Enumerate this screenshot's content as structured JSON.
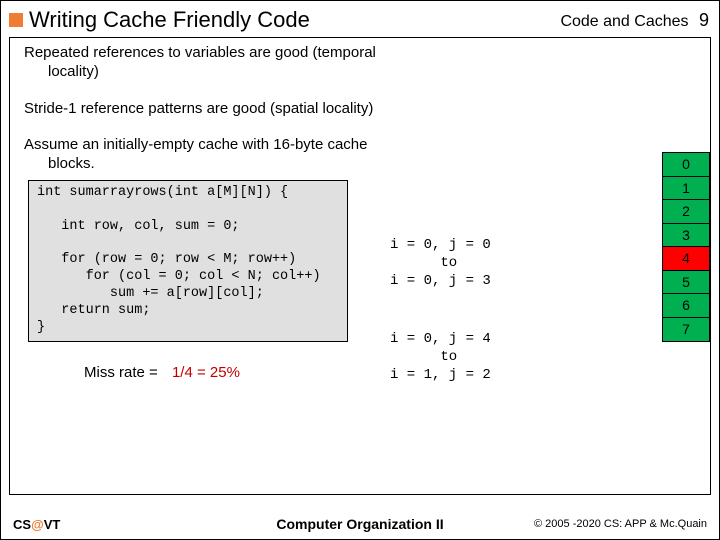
{
  "header": {
    "title": "Writing Cache Friendly Code",
    "section": "Code and Caches",
    "pagenum": "9"
  },
  "bullets": {
    "b1a": "Repeated references to variables are good (temporal",
    "b1b": "locality)",
    "b2": "Stride-1 reference patterns are good (spatial locality)",
    "b3a": "Assume an initially-empty cache with 16-byte cache",
    "b3b": "blocks."
  },
  "code": {
    "l1": "int sumarrayrows(int a[M][N]) {",
    "l2": "",
    "l3": "   int row, col, sum = 0;",
    "l4": "",
    "l5": "   for (row = 0; row < M; row++)",
    "l6": "      for (col = 0; col < N; col++)",
    "l7": "         sum += a[row][col];",
    "l8": "   return sum;",
    "l9": "}"
  },
  "trace": {
    "t1": "i = 0, j = 0\n      to\ni = 0, j = 3",
    "t2": "i = 0, j = 4\n      to\ni = 1, j = 2"
  },
  "miss": {
    "label": "Miss rate =",
    "value": "1/4 = 25%"
  },
  "blocks": {
    "b0": "0",
    "b1": "1",
    "b2": "2",
    "b3": "3",
    "b4": "4",
    "b5": "5",
    "b6": "6",
    "b7": "7"
  },
  "footer": {
    "left_a": "CS",
    "left_at": "@",
    "left_b": "VT",
    "center": "Computer Organization II",
    "right": "© 2005 -2020 CS: APP & Mc.Quain"
  },
  "chart_data": {
    "type": "table",
    "title": "Cache block index table",
    "note": "Vertical stack of 8 cache block indices; index 4 highlighted red",
    "rows": [
      {
        "index": 0,
        "highlight": false
      },
      {
        "index": 1,
        "highlight": false
      },
      {
        "index": 2,
        "highlight": false
      },
      {
        "index": 3,
        "highlight": false
      },
      {
        "index": 4,
        "highlight": true
      },
      {
        "index": 5,
        "highlight": false
      },
      {
        "index": 6,
        "highlight": false
      },
      {
        "index": 7,
        "highlight": false
      }
    ]
  }
}
